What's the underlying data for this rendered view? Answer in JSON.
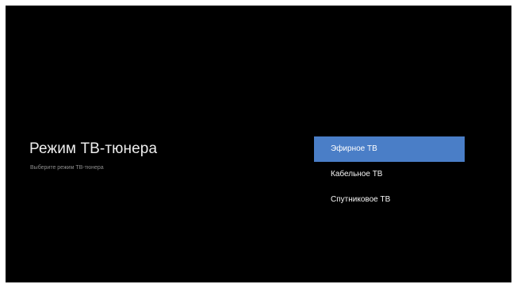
{
  "screen": {
    "title": "Режим ТВ-тюнера",
    "subtitle": "Выберите режим ТВ-тюнера",
    "background_color": "#000000",
    "accent_color": "#4a7ec7"
  },
  "menu": {
    "selected_index": 0,
    "items": [
      {
        "label": "Эфирное ТВ"
      },
      {
        "label": "Кабельное ТВ"
      },
      {
        "label": "Спутниковое ТВ"
      }
    ]
  }
}
